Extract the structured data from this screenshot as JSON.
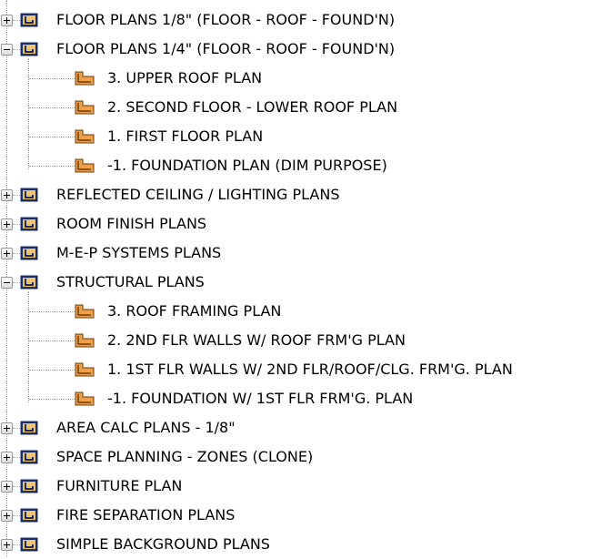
{
  "tree": {
    "nodes": [
      {
        "label": "FLOOR PLANS 1/8\" (FLOOR - ROOF - FOUND'N)",
        "level": 0,
        "expanded": false,
        "icon": "view-group-icon"
      },
      {
        "label": "FLOOR PLANS 1/4\" (FLOOR - ROOF - FOUND'N)",
        "level": 0,
        "expanded": true,
        "icon": "view-group-icon"
      },
      {
        "label": "3. UPPER ROOF PLAN",
        "level": 1,
        "icon": "floor-plan-view-icon"
      },
      {
        "label": "2. SECOND FLOOR - LOWER ROOF PLAN",
        "level": 1,
        "icon": "floor-plan-view-icon"
      },
      {
        "label": "1. FIRST FLOOR PLAN",
        "level": 1,
        "icon": "floor-plan-view-icon"
      },
      {
        "label": "-1. FOUNDATION PLAN (DIM PURPOSE)",
        "level": 1,
        "icon": "floor-plan-view-icon"
      },
      {
        "label": "REFLECTED CEILING / LIGHTING PLANS",
        "level": 0,
        "expanded": false,
        "icon": "view-group-icon"
      },
      {
        "label": "ROOM FINISH PLANS",
        "level": 0,
        "expanded": false,
        "icon": "view-group-icon"
      },
      {
        "label": "M-E-P SYSTEMS PLANS",
        "level": 0,
        "expanded": false,
        "icon": "view-group-icon"
      },
      {
        "label": "STRUCTURAL PLANS",
        "level": 0,
        "expanded": true,
        "icon": "view-group-icon"
      },
      {
        "label": "3. ROOF FRAMING PLAN",
        "level": 1,
        "icon": "floor-plan-view-icon"
      },
      {
        "label": "2. 2ND FLR WALLS W/ ROOF FRM'G PLAN",
        "level": 1,
        "icon": "floor-plan-view-icon"
      },
      {
        "label": "1. 1ST FLR WALLS W/ 2ND FLR/ROOF/CLG.  FRM'G. PLAN",
        "level": 1,
        "icon": "floor-plan-view-icon"
      },
      {
        "label": "-1. FOUNDATION W/ 1ST FLR FRM'G.  PLAN",
        "level": 1,
        "icon": "floor-plan-view-icon"
      },
      {
        "label": "AREA CALC PLANS - 1/8\"",
        "level": 0,
        "expanded": false,
        "icon": "view-group-icon"
      },
      {
        "label": "SPACE PLANNING - ZONES (CLONE)",
        "level": 0,
        "expanded": false,
        "icon": "view-group-icon"
      },
      {
        "label": "FURNITURE PLAN",
        "level": 0,
        "expanded": false,
        "icon": "view-group-icon"
      },
      {
        "label": "FIRE SEPARATION PLANS",
        "level": 0,
        "expanded": false,
        "icon": "view-group-icon"
      },
      {
        "label": "SIMPLE BACKGROUND PLANS",
        "level": 0,
        "expanded": false,
        "icon": "view-group-icon"
      }
    ]
  },
  "colors": {
    "group_icon_fill": "#f1c36a",
    "group_icon_border": "#1c2f6b",
    "plan_icon_fill": "#f0a04b",
    "plan_icon_border": "#6b3a08",
    "tree_lines": "#a0a0a0"
  }
}
